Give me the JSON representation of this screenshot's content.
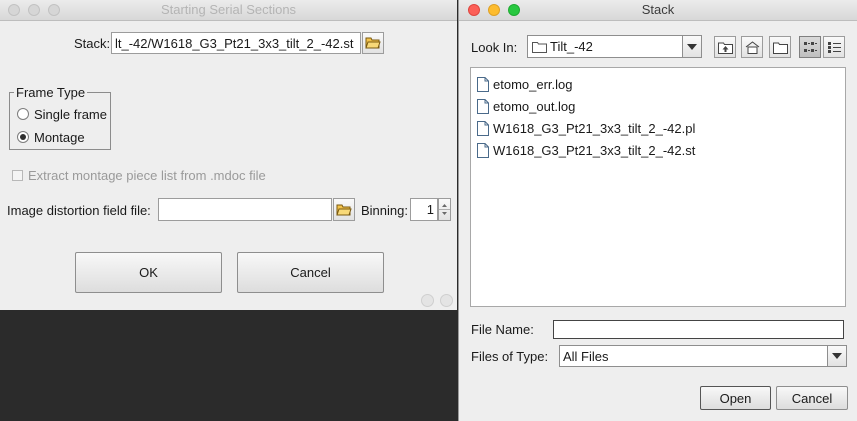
{
  "serial_dialog": {
    "title": "Starting Serial Sections",
    "stack_label": "Stack:",
    "stack_value": "lt_-42/W1618_G3_Pt21_3x3_tilt_2_-42.st",
    "frame_type": {
      "legend": "Frame Type",
      "options": [
        "Single frame",
        "Montage"
      ],
      "selected": "Montage"
    },
    "extract_label": "Extract montage piece list from .mdoc file",
    "distortion_label": "Image distortion field file:",
    "distortion_value": "",
    "binning_label": "Binning:",
    "binning_value": "1",
    "ok_label": "OK",
    "cancel_label": "Cancel"
  },
  "stack_dialog": {
    "title": "Stack",
    "look_in_label": "Look In:",
    "look_in_value": "Tilt_-42",
    "files": [
      "etomo_err.log",
      "etomo_out.log",
      "W1618_G3_Pt21_3x3_tilt_2_-42.pl",
      "W1618_G3_Pt21_3x3_tilt_2_-42.st"
    ],
    "file_name_label": "File Name:",
    "file_name_value": "",
    "files_of_type_label": "Files of Type:",
    "files_of_type_value": "All Files",
    "open_label": "Open",
    "cancel_label": "Cancel"
  }
}
